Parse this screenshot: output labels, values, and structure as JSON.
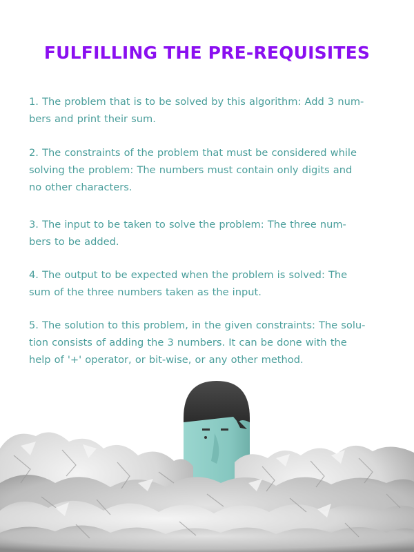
{
  "title": "FULFILLING THE PRE-REQUISITES",
  "colors": {
    "title": "#8a0ff0",
    "body_text": "#4a9e9b",
    "character_face": "#8fcdc6",
    "character_hair": "#3a3a3a",
    "paper": "#e6e6e6"
  },
  "items": [
    {
      "line1": "1. The problem that is to be solved by this algorithm: Add 3 num-",
      "line2": "bers and print their sum."
    },
    {
      "line1": "2. The constraints of the problem that must be considered  while",
      "line2": "solving the problem: The numbers must contain only digits and",
      "line3": "no other characters."
    },
    {
      "line1": "3. The input to be taken to solve the problem: The three num-",
      "line2": "bers to be added."
    },
    {
      "line1": "4. The output to be expected when the problem is solved: The",
      "line2": "sum of the three numbers taken as the input."
    },
    {
      "line1": "5. The solution to this problem, in the given constraints: The solu-",
      "line2": "tion consists of adding the 3 numbers. It can be done with the",
      "line3": "help of  '+' operator, or bit-wise, or any other method."
    }
  ],
  "illustration": {
    "icon": "character-in-crumpled-paper-illustration"
  }
}
